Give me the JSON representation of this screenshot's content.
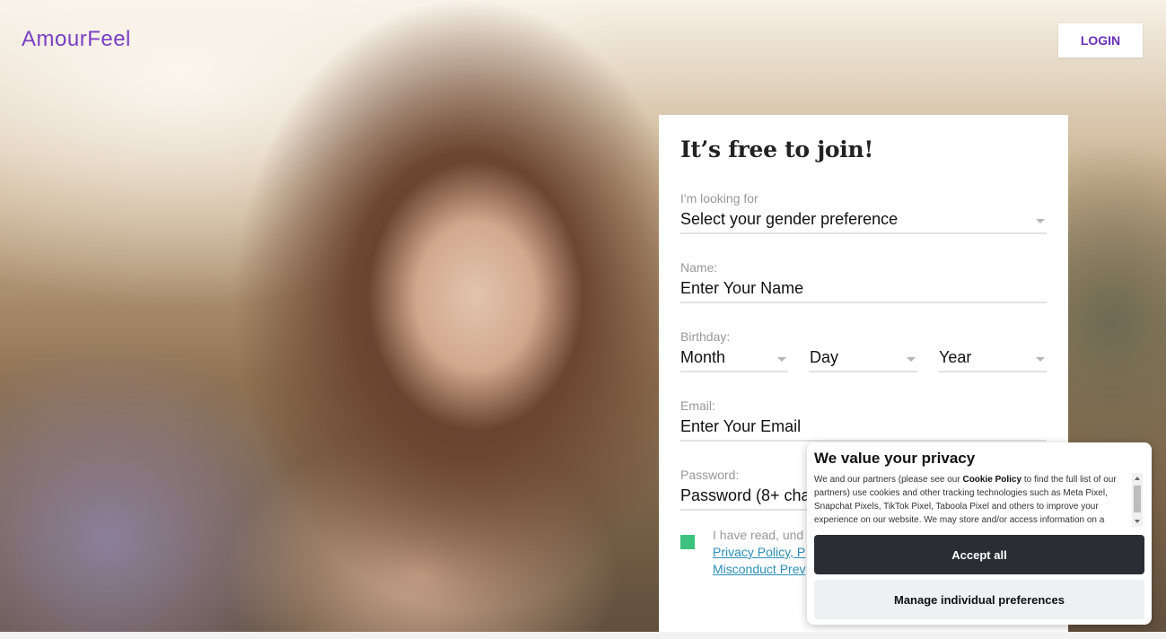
{
  "header": {
    "logo": "AmourFeel",
    "login_label": "LOGIN"
  },
  "form": {
    "title": "It’s free to join!",
    "looking_for": {
      "label": "I'm looking for",
      "value": "Select your gender preference"
    },
    "name": {
      "label": "Name:",
      "placeholder": "Enter Your Name"
    },
    "birthday": {
      "label": "Birthday:",
      "month": "Month",
      "day": "Day",
      "year": "Year"
    },
    "email": {
      "label": "Email:",
      "placeholder": "Enter Your Email"
    },
    "password": {
      "label": "Password:",
      "placeholder": "Password (8+ cha"
    },
    "terms": {
      "text": "I have read, und",
      "link1": "Privacy Policy, P",
      "link2": "Misconduct Prev"
    }
  },
  "cookie": {
    "title": "We value your privacy",
    "body_pre": "We and our partners (please see our ",
    "body_bold": "Cookie Policy",
    "body_post": " to find the full list of our partners) use cookies and other tracking technologies such as Meta Pixel, Snapchat Pixels, TikTok Pixel, Taboola Pixel and others to improve your experience on our website. We may store and/or access information on a device",
    "accept_label": "Accept all",
    "manage_label": "Manage individual preferences"
  },
  "colors": {
    "brand": "#7b3fc4",
    "checkbox": "#3cc27c",
    "link": "#2b8fb8",
    "accept_bg": "#2a2d34"
  }
}
